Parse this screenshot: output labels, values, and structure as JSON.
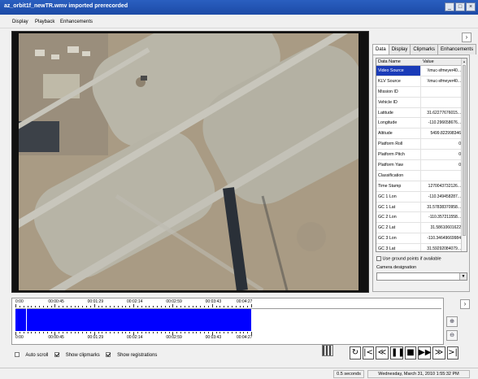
{
  "window": {
    "title": "az_orbit1f_newTR.wmv imported prerecorded",
    "buttons": [
      "_",
      "□",
      "×"
    ]
  },
  "menu": [
    "Display",
    "Playback",
    "Enhancements"
  ],
  "panel": {
    "tabs": [
      "Data",
      "Display",
      "Clipmarks",
      "Enhancements"
    ],
    "active_tab": "Data",
    "grid_headers": [
      "Data Name",
      "Value"
    ],
    "rows": [
      {
        "name": "Video Source",
        "value": "\\\\muc-sfmeyer40..."
      },
      {
        "name": "KLV Source",
        "value": "\\\\muc-sfmeyer40..."
      },
      {
        "name": "Mission ID",
        "value": ""
      },
      {
        "name": "Vehicle ID",
        "value": ""
      },
      {
        "name": "Latitude",
        "value": "31.62277676015..."
      },
      {
        "name": "Longitude",
        "value": "-110.296658676..."
      },
      {
        "name": "Altitude",
        "value": "5499.822998346"
      },
      {
        "name": "Platform Roll",
        "value": "0"
      },
      {
        "name": "Platform Pitch",
        "value": "0"
      },
      {
        "name": "Platform Yaw",
        "value": "0"
      },
      {
        "name": "Classification",
        "value": ""
      },
      {
        "name": "Time Stamp",
        "value": "1270043732126..."
      },
      {
        "name": "GC 1 Lon",
        "value": "-110.349458287..."
      },
      {
        "name": "GC 1 Lat",
        "value": "31.57838370958..."
      },
      {
        "name": "GC 2 Lon",
        "value": "-110.357211558..."
      },
      {
        "name": "GC 2 Lat",
        "value": "31.58610601622"
      },
      {
        "name": "GC 3 Lon",
        "value": "-110.34649669984"
      },
      {
        "name": "GC 3 Lat",
        "value": "31.59292084079..."
      }
    ],
    "use_ground_points": "Use ground points if available",
    "camera_designation": "Camera designation",
    "camera_value": ""
  },
  "timeline": {
    "labels": [
      "0:00",
      "00:00:45",
      "00:01:29",
      "00:02:14",
      "00:02:59",
      "00:03:43",
      "00:04:27"
    ]
  },
  "options": {
    "auto_scroll": "Auto scroll",
    "show_clipmarks": "Show clipmarks",
    "show_registrations": "Show registrations"
  },
  "controls": [
    "↻",
    "|<",
    "≪",
    "❚❚",
    "■",
    "▶▶",
    "≫",
    ">|"
  ],
  "status": {
    "speed": "0.5 seconds",
    "datetime": "Wednesday, March 31, 2010 1:55:32 PM"
  }
}
